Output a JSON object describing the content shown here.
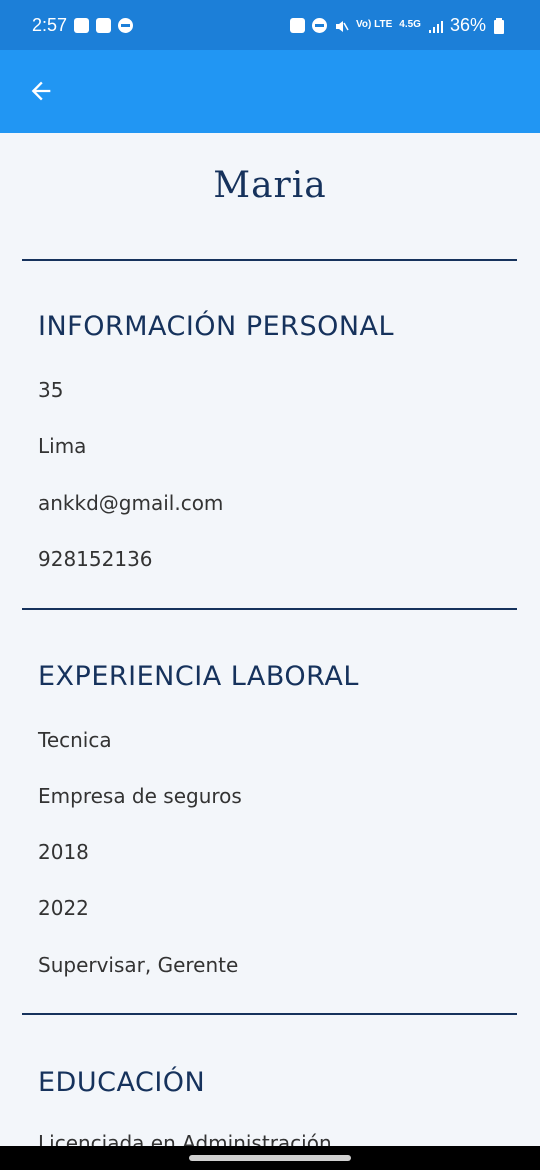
{
  "status_bar": {
    "time": "2:57",
    "battery": "36%",
    "network": "4.5G",
    "volte": "Vo) LTE"
  },
  "profile": {
    "name": "Maria"
  },
  "sections": {
    "personal": {
      "title": "INFORMACIÓN PERSONAL",
      "items": [
        "35",
        "Lima",
        "ankkd@gmail.com",
        "928152136"
      ]
    },
    "experience": {
      "title": "EXPERIENCIA LABORAL",
      "items": [
        "Tecnica",
        "Empresa de seguros",
        "2018",
        "2022",
        "Supervisar, Gerente"
      ]
    },
    "education": {
      "title": "EDUCACIÓN",
      "items": [
        "Licenciada en Administración"
      ]
    }
  },
  "colors": {
    "status_bar": "#1c7fd8",
    "app_bar": "#2196f3",
    "background": "#f3f6fa",
    "heading": "#16325c",
    "body_text": "#333333"
  },
  "icons": {
    "back": "arrow-left-icon"
  }
}
